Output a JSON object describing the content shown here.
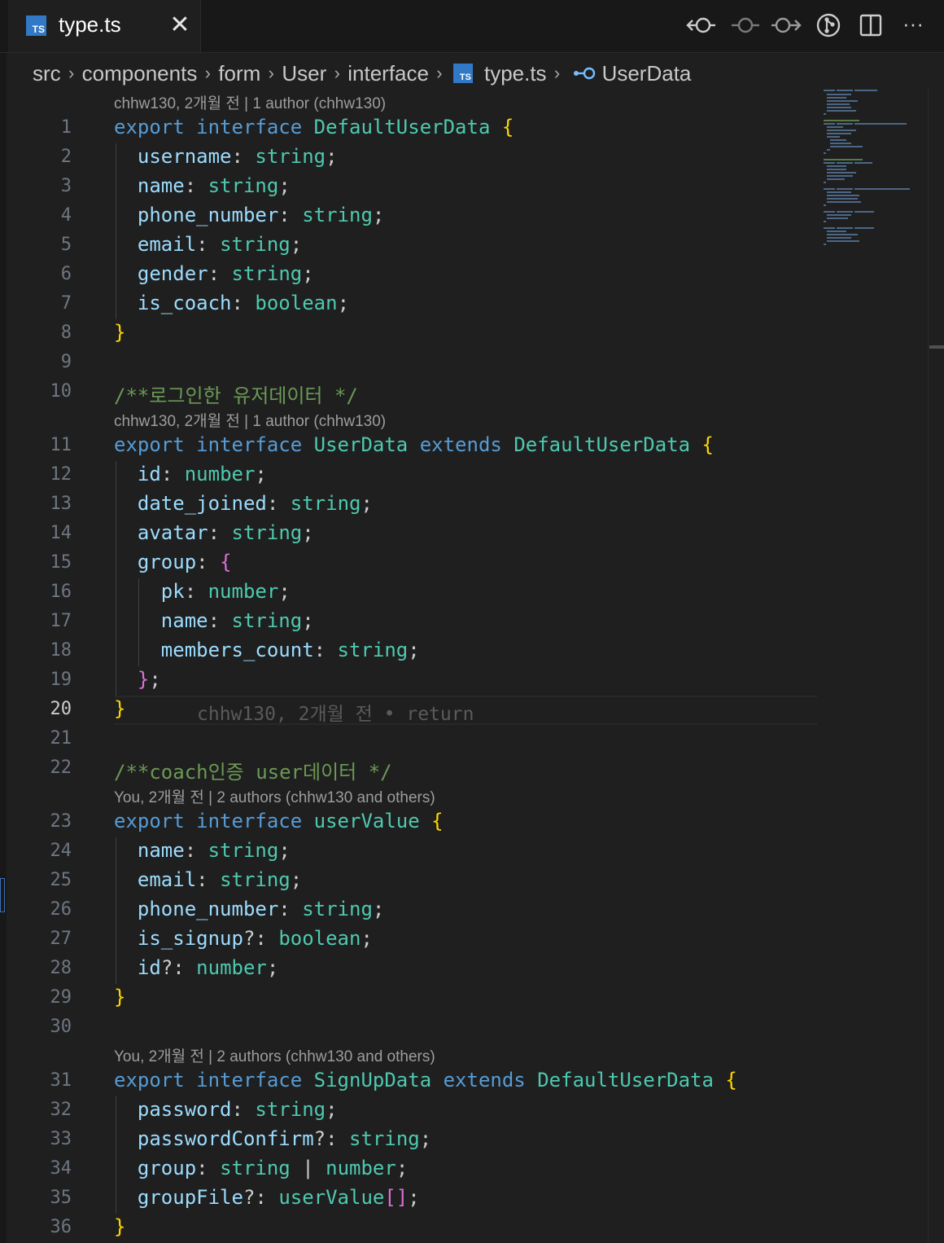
{
  "tab": {
    "label": "type.ts",
    "icon": "typescript-file-icon",
    "icon_text": "TS",
    "close_glyph": "✕"
  },
  "toolbar": {
    "buttons": [
      "open-changes-with-previous-revision-icon",
      "open-line-changes-icon",
      "open-changes-with-next-revision-icon",
      "source-control-graph-icon",
      "split-editor-icon",
      "more-actions-icon"
    ],
    "more_glyph": "···"
  },
  "breadcrumb": {
    "items": [
      "src",
      "components",
      "form",
      "User",
      "interface",
      "type.ts",
      "UserData"
    ],
    "separator": "›",
    "file_icon_text": "TS"
  },
  "editor": {
    "active_line": 20,
    "line_numbers": [
      "1",
      "2",
      "3",
      "4",
      "5",
      "6",
      "7",
      "8",
      "9",
      "10",
      "11",
      "12",
      "13",
      "14",
      "15",
      "16",
      "17",
      "18",
      "19",
      "20",
      "21",
      "22",
      "23",
      "24",
      "25",
      "26",
      "27",
      "28",
      "29",
      "30",
      "31",
      "32",
      "33",
      "34",
      "35",
      "36"
    ],
    "codelens": {
      "l1": "chhw130, 2개월 전 | 1 author (chhw130)",
      "l11": "chhw130, 2개월 전 | 1 author (chhw130)",
      "l23": "You, 2개월 전 | 2 authors (chhw130 and others)",
      "l31": "You, 2개월 전 | 2 authors (chhw130 and others)"
    },
    "inline_blame": "chhw130, 2개월 전 • return",
    "words": {
      "export": "export",
      "interface": "interface",
      "extends": "extends",
      "string": "string",
      "boolean": "boolean",
      "number": "number",
      "DefaultUserData": "DefaultUserData",
      "UserData": "UserData",
      "userValue": "userValue",
      "SignUpData": "SignUpData",
      "username": "username",
      "name": "name",
      "phone_number": "phone_number",
      "email": "email",
      "gender": "gender",
      "is_coach": "is_coach",
      "id": "id",
      "date_joined": "date_joined",
      "avatar": "avatar",
      "group": "group",
      "pk": "pk",
      "members_count": "members_count",
      "is_signup": "is_signup",
      "password": "password",
      "passwordConfirm": "passwordConfirm",
      "groupFile": "groupFile",
      "comment10": "/**로그인한 유저데이터 */",
      "comment22": "/**coach인증 user데이터 */"
    }
  },
  "colors": {
    "background": "#1f1f1f",
    "keyword": "#569cd6",
    "type": "#4ec9b0",
    "property": "#9cdcfe",
    "comment": "#6a9955",
    "bracket_gold": "#ffd700",
    "bracket_orchid": "#da70d6",
    "bracket_blue": "#179fff",
    "typescript_icon": "#3178c6"
  }
}
